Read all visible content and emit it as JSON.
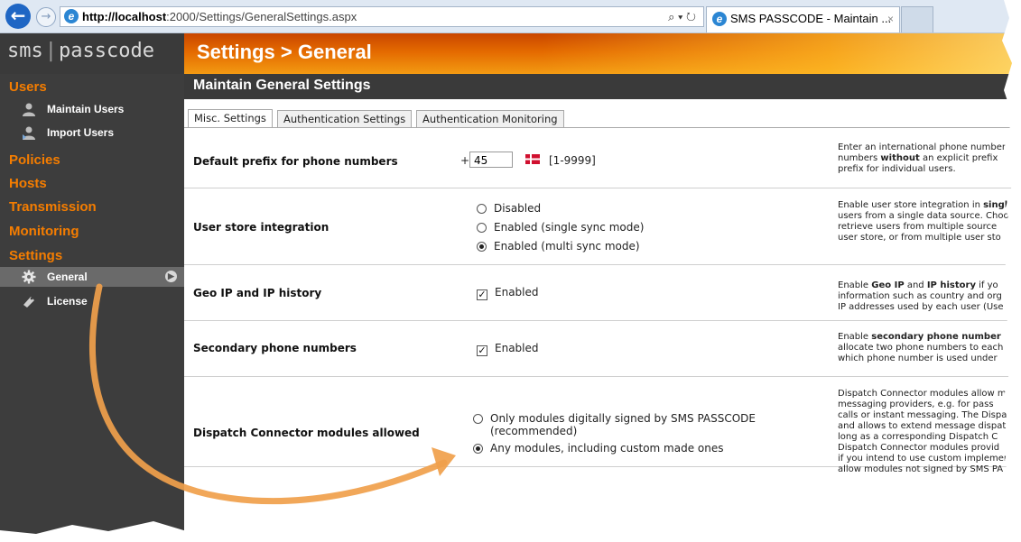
{
  "browser": {
    "url_host": "http://localhost",
    "url_path": ":2000/Settings/GeneralSettings.aspx",
    "search_controls": "⌕ ▾ ↻",
    "tab_title": "SMS PASSCODE - Maintain ...",
    "tab_close": "×"
  },
  "header": {
    "logo_left": "sms",
    "logo_right": "passcode",
    "page_title": "Settings > General"
  },
  "sidebar": {
    "users": "Users",
    "maintain_users": "Maintain Users",
    "import_users": "Import Users",
    "policies": "Policies",
    "hosts": "Hosts",
    "transmission": "Transmission",
    "monitoring": "Monitoring",
    "settings": "Settings",
    "general": "General",
    "license": "License"
  },
  "main": {
    "section_title": "Maintain General Settings",
    "tabs": [
      "Misc. Settings",
      "Authentication Settings",
      "Authentication Monitoring"
    ],
    "rows": {
      "prefix": {
        "label": "Default prefix for phone numbers",
        "plus": "+",
        "value": "45",
        "range": "[1-9999]",
        "desc_1": "Enter an international phone number",
        "desc_2a": "numbers ",
        "desc_2b": "without",
        "desc_2c": " an explicit prefix",
        "desc_3": "prefix for individual users."
      },
      "store": {
        "label": "User store integration",
        "opt1": "Disabled",
        "opt2": "Enabled (single sync mode)",
        "opt3": "Enabled (multi sync mode)",
        "desc_1a": "Enable user store integration in ",
        "desc_1b": "singl",
        "desc_2": "users from a single data source. Choo",
        "desc_3": "retrieve users from multiple source",
        "desc_4": "user store, or from multiple user sto"
      },
      "geo": {
        "label": "Geo IP and IP history",
        "opt": "Enabled",
        "desc_1a": "Enable ",
        "desc_1b": "Geo IP",
        "desc_1c": " and ",
        "desc_1d": "IP history",
        "desc_1e": " if yo",
        "desc_2": "information such as country and org",
        "desc_3": "IP addresses used by each user (Use"
      },
      "secondary": {
        "label": "Secondary phone numbers",
        "opt": "Enabled",
        "desc_1a": "Enable ",
        "desc_1b": "secondary phone number",
        "desc_2": "allocate two phone numbers to each",
        "desc_3": "which phone number is used under"
      },
      "dispatch": {
        "label": "Dispatch Connector modules allowed",
        "opt1_a": "Only modules digitally signed by SMS PASSCODE",
        "opt1_b": "(recommended)",
        "opt2": "Any modules, including custom made ones",
        "desc": [
          "Dispatch Connector modules allow m",
          "messaging providers, e.g. for pass",
          "calls or instant messaging. The Dispa",
          "and allows to extend message dispat",
          "long as a corresponding Dispatch C",
          "Dispatch Connector modules provid",
          "if you intend to use custom implemen",
          "allow modules not signed by SMS PA"
        ]
      }
    }
  },
  "colors": {
    "accent_orange": "#f57d00",
    "annotation_arrow": "#f0a04b",
    "sidebar_bg": "#3d3d3d"
  }
}
